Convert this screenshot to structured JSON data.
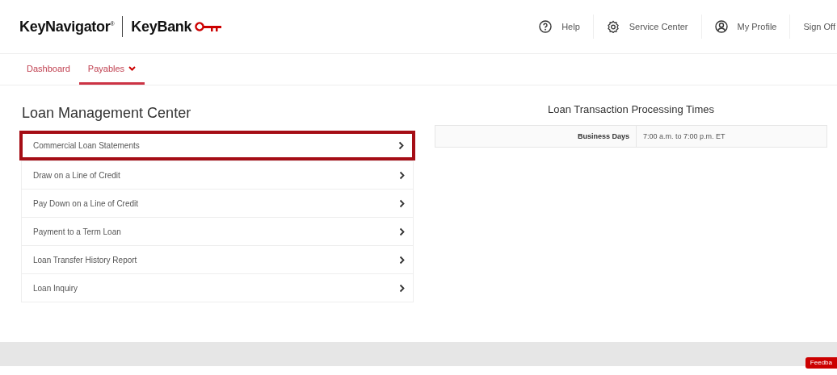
{
  "header": {
    "product": "KeyNavigator",
    "product_mark": "®",
    "bank": "KeyBank",
    "links": [
      {
        "kind": "help",
        "label": "Help"
      },
      {
        "kind": "gear",
        "label": "Service Center"
      },
      {
        "kind": "profile",
        "label": "My Profile"
      },
      {
        "kind": "plain",
        "label": "Sign Off"
      }
    ]
  },
  "nav": [
    {
      "label": "Dashboard",
      "selected": false,
      "dropdown": false
    },
    {
      "label": "Payables",
      "selected": true,
      "dropdown": true
    }
  ],
  "loan_center": {
    "title": "Loan Management Center",
    "items": [
      {
        "label": "Commercial Loan Statements",
        "highlighted": true
      },
      {
        "label": "Draw on a Line of Credit",
        "highlighted": false
      },
      {
        "label": "Pay Down on a Line of Credit",
        "highlighted": false
      },
      {
        "label": "Payment to a Term Loan",
        "highlighted": false
      },
      {
        "label": "Loan Transfer History Report",
        "highlighted": false
      },
      {
        "label": "Loan Inquiry",
        "highlighted": false
      }
    ]
  },
  "processing_times": {
    "title": "Loan Transaction Processing Times",
    "rows": [
      {
        "label": "Business Days",
        "value": "7:00 a.m. to 7:00 p.m. ET"
      }
    ]
  },
  "feedback_tab": {
    "label": "Feedba"
  }
}
